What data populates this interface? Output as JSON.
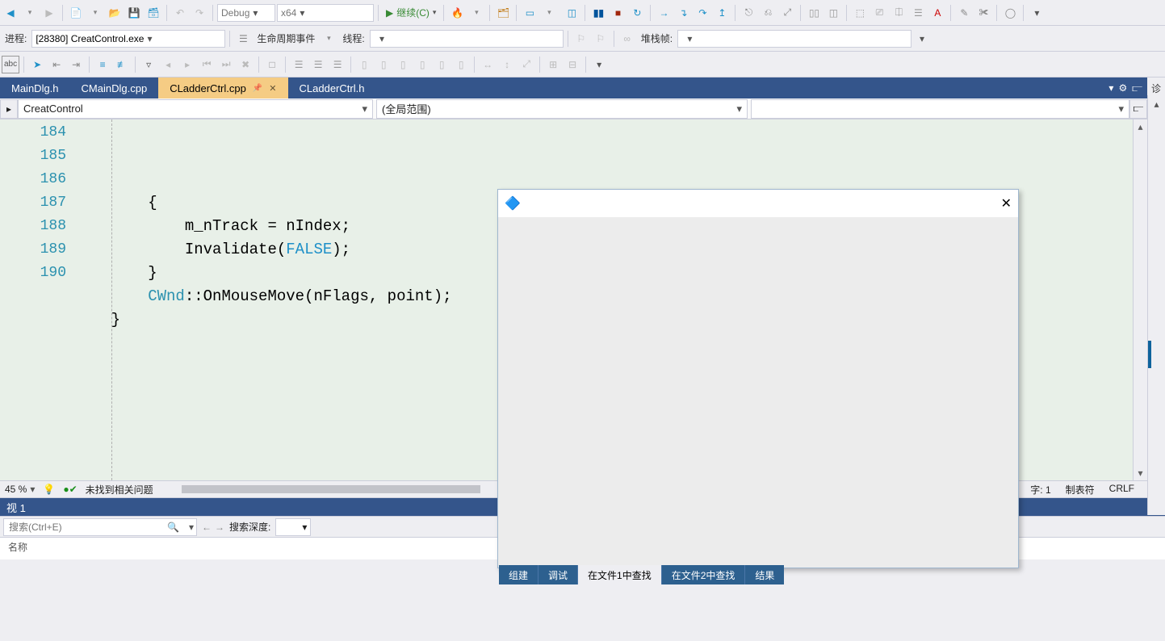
{
  "toolbar1": {
    "config": "Debug",
    "platform": "x64",
    "continue_label": "继续(C)"
  },
  "toolbar_debug": {
    "process_label": "进程:",
    "process_value": "[28380] CreatControl.exe",
    "lifecycle_label": "生命周期事件",
    "thread_label": "线程:",
    "stackframe_label": "堆栈帧:"
  },
  "tabs": [
    {
      "label": "MainDlg.h",
      "active": false
    },
    {
      "label": "CMainDlg.cpp",
      "active": false
    },
    {
      "label": "CLadderCtrl.cpp",
      "active": true,
      "pinned": true
    },
    {
      "label": "CLadderCtrl.h",
      "active": false
    }
  ],
  "nav": {
    "left": "CreatControl",
    "middle": "(全局范围)",
    "right": ""
  },
  "code": {
    "lines": [
      {
        "n": 184,
        "text": "        {"
      },
      {
        "n": 185,
        "text": "            m_nTrack = nIndex;"
      },
      {
        "n": 186,
        "text": "            Invalidate(FALSE);"
      },
      {
        "n": 187,
        "text": "        }"
      },
      {
        "n": 188,
        "text": "        CWnd::OnMouseMove(nFlags, point);"
      },
      {
        "n": 189,
        "text": "    }"
      },
      {
        "n": 190,
        "text": ""
      }
    ]
  },
  "editor_status": {
    "zoom": "45 %",
    "issues": "未找到相关问题",
    "col_stat": "字: 1",
    "indent": "制表符",
    "eol": "CRLF"
  },
  "watch_panel": {
    "title": "视 1",
    "search_placeholder": "搜索(Ctrl+E)",
    "depth_label": "搜索深度:",
    "col_name": "名称"
  },
  "output_tabs": {
    "t1": "组建",
    "t2": "调试",
    "t3": "在文件1中查找",
    "t4": "在文件2中查找",
    "t5": "结果"
  },
  "right_dock": {
    "item1": "诊"
  }
}
